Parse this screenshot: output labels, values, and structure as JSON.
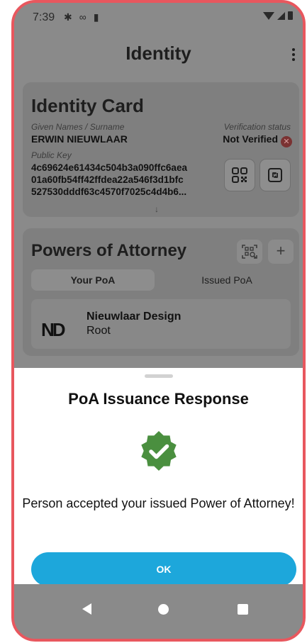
{
  "status_bar": {
    "time": "7:39",
    "icons_left": [
      "gear-icon",
      "link-icon",
      "sd-card-icon"
    ],
    "icons_right": [
      "wifi-icon",
      "signal-icon",
      "battery-icon"
    ]
  },
  "app_bar": {
    "title": "Identity",
    "menu_icon": "more-vert-icon"
  },
  "identity_card": {
    "title": "Identity Card",
    "name_label": "Given Names / Surname",
    "name_value": "ERWIN NIEUWLAAR",
    "verification_label": "Verification status",
    "verification_value": "Not Verified",
    "pubkey_label": "Public Key",
    "pubkey_lines": [
      "4c69624e61434c504b3a090ffc6aea",
      "01a60fb54ff42ffdea22a546f3d1bfc",
      "527530dddf63c4570f7025c4d4b6..."
    ],
    "expand_arrow": "↓",
    "qr_button_icon": "qr-code-icon",
    "nfc_button_icon": "nfc-icon"
  },
  "poa_card": {
    "title": "Powers of Attorney",
    "scan_icon": "qr-scan-icon",
    "add_label": "+",
    "tabs": [
      {
        "label": "Your PoA",
        "active": true
      },
      {
        "label": "Issued PoA",
        "active": false
      }
    ],
    "items": [
      {
        "logo": "ND",
        "name": "Nieuwlaar Design",
        "role": "Root"
      }
    ]
  },
  "sheet": {
    "title": "PoA Issuance Response",
    "badge_icon": "verified-check-badge-icon",
    "badge_color": "#4a8f3f",
    "message": "Person accepted your issued Power of Attorney!",
    "ok_label": "OK",
    "ok_color": "#1da7db"
  },
  "nav_bar": {
    "icons": [
      "back-icon",
      "home-icon",
      "recents-icon"
    ]
  }
}
